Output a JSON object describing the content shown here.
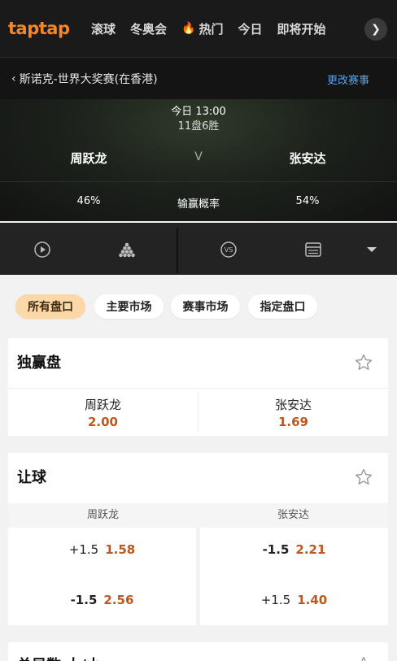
{
  "app": {
    "logo": "taptap"
  },
  "nav": {
    "items": [
      {
        "label": "滚球",
        "icon": ""
      },
      {
        "label": "冬奥会",
        "icon": ""
      },
      {
        "label": "热门",
        "icon": "fire-icon"
      },
      {
        "label": "今日",
        "icon": ""
      },
      {
        "label": "即将开始",
        "icon": ""
      }
    ]
  },
  "event": {
    "back_icon": "chevron-left-icon",
    "title": "斯诺克-世界大奖赛(在香港)",
    "change_label": "更改赛事"
  },
  "match": {
    "time": "今日 13:00",
    "format": "11盘6胜",
    "player_a": "周跃龙",
    "player_b": "张安达",
    "vs": "V",
    "prob_label": "输赢概率",
    "prob_a": "46%",
    "prob_b": "54%"
  },
  "toolbar": {
    "icons": [
      "play-icon",
      "snooker-balls-icon",
      "vs-icon",
      "scoreboard-icon",
      "dropdown-arrow-icon"
    ]
  },
  "filters": {
    "chips": [
      "所有盘口",
      "主要市场",
      "赛事市场",
      "指定盘口"
    ],
    "active_index": 0
  },
  "markets": {
    "moneyline": {
      "title": "独赢盘",
      "a_name": "周跃龙",
      "a_odds": "2.00",
      "b_name": "张安达",
      "b_odds": "1.69"
    },
    "handicap": {
      "title": "让球",
      "col_a": "周跃龙",
      "col_b": "张安达",
      "a_rows": [
        {
          "point": "+1.5",
          "odds": "1.58"
        },
        {
          "point": "-1.5",
          "odds": "2.56"
        }
      ],
      "b_rows": [
        {
          "point": "-1.5",
          "odds": "2.21"
        },
        {
          "point": "+1.5",
          "odds": "1.40"
        }
      ]
    },
    "next_title": "总局数 大/小"
  },
  "colors": {
    "accent_orange": "#f4862a",
    "odds_orange": "#c0561e",
    "link_blue": "#5aa2e6",
    "chip_active": "#fcd7a8"
  }
}
